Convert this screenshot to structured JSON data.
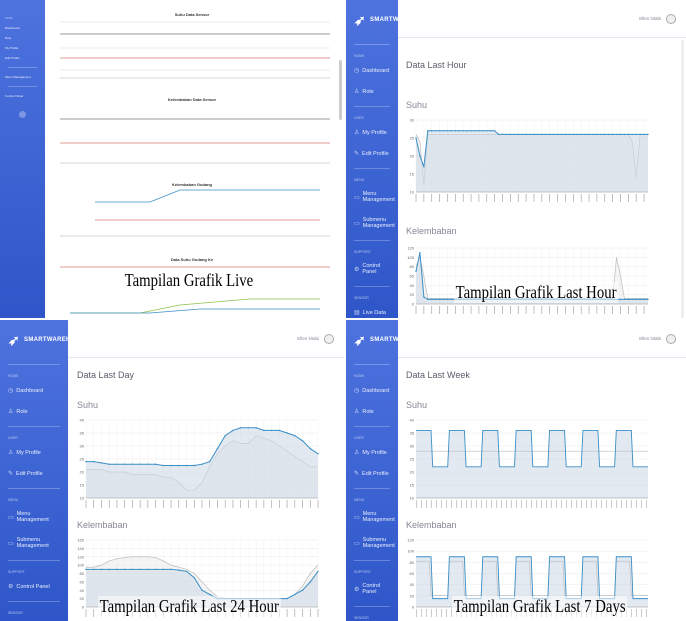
{
  "app_name": "SMARTWAREH",
  "user_name": "Ellen Ntabi",
  "sidebar": {
    "section_home": "HOME",
    "dashboard": "Dashboard",
    "role": "Role",
    "section_user": "USER",
    "my_profile": "My Profile",
    "edit_profile": "Edit Profile",
    "section_menu": "MENU",
    "menu_management": "Menu Management",
    "submenu_management": "Submenu Management",
    "section_support": "SUPPORT",
    "control_panel": "Control Panel",
    "section_sensor": "SENSOR",
    "live_data": "Live Data"
  },
  "panels": {
    "live": {
      "caption": "Tampilan Grafik Live",
      "chart_titles": [
        "Suhu Data Sensor",
        "Kelembaban Data Sensor",
        "Kelembaban Gudang",
        "Data Suhu Gudang Ke"
      ]
    },
    "hour": {
      "heading": "Data Last Hour",
      "caption": "Tampilan Grafik Last Hour",
      "suhu": "Suhu",
      "kelembaban": "Kelembaban"
    },
    "day": {
      "heading": "Data Last Day",
      "caption": "Tampilan Grafik Last 24 Hour",
      "suhu": "Suhu",
      "kelembaban": "Kelembaban"
    },
    "week": {
      "heading": "Data Last Week",
      "caption": "Tampilan Grafik Last 7 Days",
      "suhu": "Suhu",
      "kelembaban": "Kelembaban"
    }
  },
  "colors": {
    "sidebar": "#4e73df",
    "line_primary": "#3a8fc7",
    "line_secondary": "#bbbbbb",
    "fill": "#cfdbe6"
  },
  "chart_data": [
    {
      "type": "line",
      "title": "Suhu",
      "panel": "hour",
      "ylim": [
        10,
        30
      ],
      "y_ticks": [
        10,
        15,
        20,
        25,
        30
      ],
      "series": [
        {
          "values": [
            25,
            20,
            17,
            27,
            27,
            27,
            27,
            27,
            27,
            27,
            27,
            27,
            27,
            27,
            27,
            27,
            27,
            27,
            27,
            27,
            27,
            26,
            26,
            26,
            26,
            26,
            26,
            26,
            26,
            26,
            26,
            26,
            26,
            26,
            26,
            26,
            26,
            26,
            26,
            26,
            26,
            26,
            26,
            26,
            26,
            26,
            26,
            26,
            26,
            26,
            26,
            26,
            26,
            26,
            26,
            26,
            26,
            26,
            26,
            26
          ]
        },
        {
          "values": [
            26,
            24,
            12,
            26,
            26,
            26,
            26,
            26,
            26,
            26,
            26,
            26,
            26,
            26,
            26,
            26,
            26,
            26,
            26,
            26,
            26,
            26,
            26,
            26,
            26,
            26,
            26,
            26,
            26,
            26,
            26,
            26,
            26,
            26,
            26,
            26,
            26,
            26,
            26,
            26,
            26,
            26,
            26,
            26,
            26,
            26,
            26,
            26,
            26,
            26,
            26,
            26,
            26,
            26,
            26,
            24,
            14,
            26,
            26,
            26
          ]
        }
      ]
    },
    {
      "type": "line",
      "title": "Kelembaban",
      "panel": "hour",
      "ylim": [
        0,
        120
      ],
      "y_ticks": [
        0,
        20,
        40,
        60,
        80,
        100,
        120
      ],
      "series": [
        {
          "values": [
            70,
            110,
            15,
            10,
            10,
            10,
            10,
            10,
            10,
            10,
            10,
            10,
            10,
            10,
            10,
            10,
            10,
            10,
            10,
            10,
            10,
            10,
            10,
            10,
            10,
            10,
            10,
            10,
            10,
            10,
            10,
            10,
            10,
            10,
            10,
            10,
            10,
            10,
            10,
            10,
            10,
            10,
            10,
            10,
            10,
            10,
            10,
            10,
            10,
            10,
            10,
            10,
            10,
            10,
            10,
            10,
            10,
            10,
            10,
            10
          ]
        },
        {
          "values": [
            80,
            100,
            60,
            12,
            12,
            12,
            12,
            12,
            12,
            12,
            12,
            12,
            12,
            12,
            12,
            12,
            12,
            12,
            12,
            12,
            12,
            12,
            12,
            12,
            12,
            12,
            12,
            12,
            12,
            12,
            12,
            12,
            12,
            12,
            12,
            12,
            12,
            12,
            12,
            12,
            12,
            12,
            12,
            12,
            12,
            12,
            12,
            12,
            12,
            12,
            12,
            100,
            60,
            12,
            12,
            12,
            12,
            12,
            12,
            12
          ]
        }
      ]
    },
    {
      "type": "line",
      "title": "Suhu",
      "panel": "day",
      "ylim": [
        10,
        40
      ],
      "y_ticks": [
        10,
        15,
        20,
        25,
        30,
        35,
        40
      ],
      "series": [
        {
          "values": [
            24,
            24,
            23.5,
            23,
            23,
            23,
            23,
            23,
            23,
            23,
            22.5,
            22.5,
            22.5,
            22.5,
            22.5,
            23,
            24,
            29,
            34,
            36,
            37,
            37,
            37,
            36,
            36,
            36,
            35,
            34,
            32,
            29,
            27
          ]
        },
        {
          "values": [
            21,
            21,
            21,
            20,
            20,
            20,
            19,
            19,
            19,
            19,
            18,
            18,
            16,
            13,
            13,
            16,
            22,
            27,
            30,
            32,
            31,
            31,
            34,
            33,
            32,
            30,
            28,
            26,
            24,
            22,
            22
          ]
        }
      ]
    },
    {
      "type": "line",
      "title": "Kelembaban",
      "panel": "day",
      "ylim": [
        0,
        160
      ],
      "y_ticks": [
        0,
        20,
        40,
        60,
        80,
        100,
        120,
        140,
        160
      ],
      "series": [
        {
          "values": [
            90,
            90,
            90,
            90,
            90,
            90,
            90,
            90,
            90,
            90,
            90,
            90,
            88,
            85,
            70,
            40,
            30,
            20,
            20,
            20,
            20,
            20,
            20,
            20,
            20,
            20,
            20,
            30,
            40,
            60,
            85
          ]
        },
        {
          "values": [
            95,
            95,
            100,
            110,
            115,
            118,
            120,
            120,
            120,
            118,
            110,
            100,
            95,
            90,
            80,
            60,
            40,
            25,
            20,
            20,
            20,
            20,
            20,
            20,
            20,
            20,
            20,
            30,
            50,
            80,
            100
          ]
        }
      ]
    }
  ]
}
